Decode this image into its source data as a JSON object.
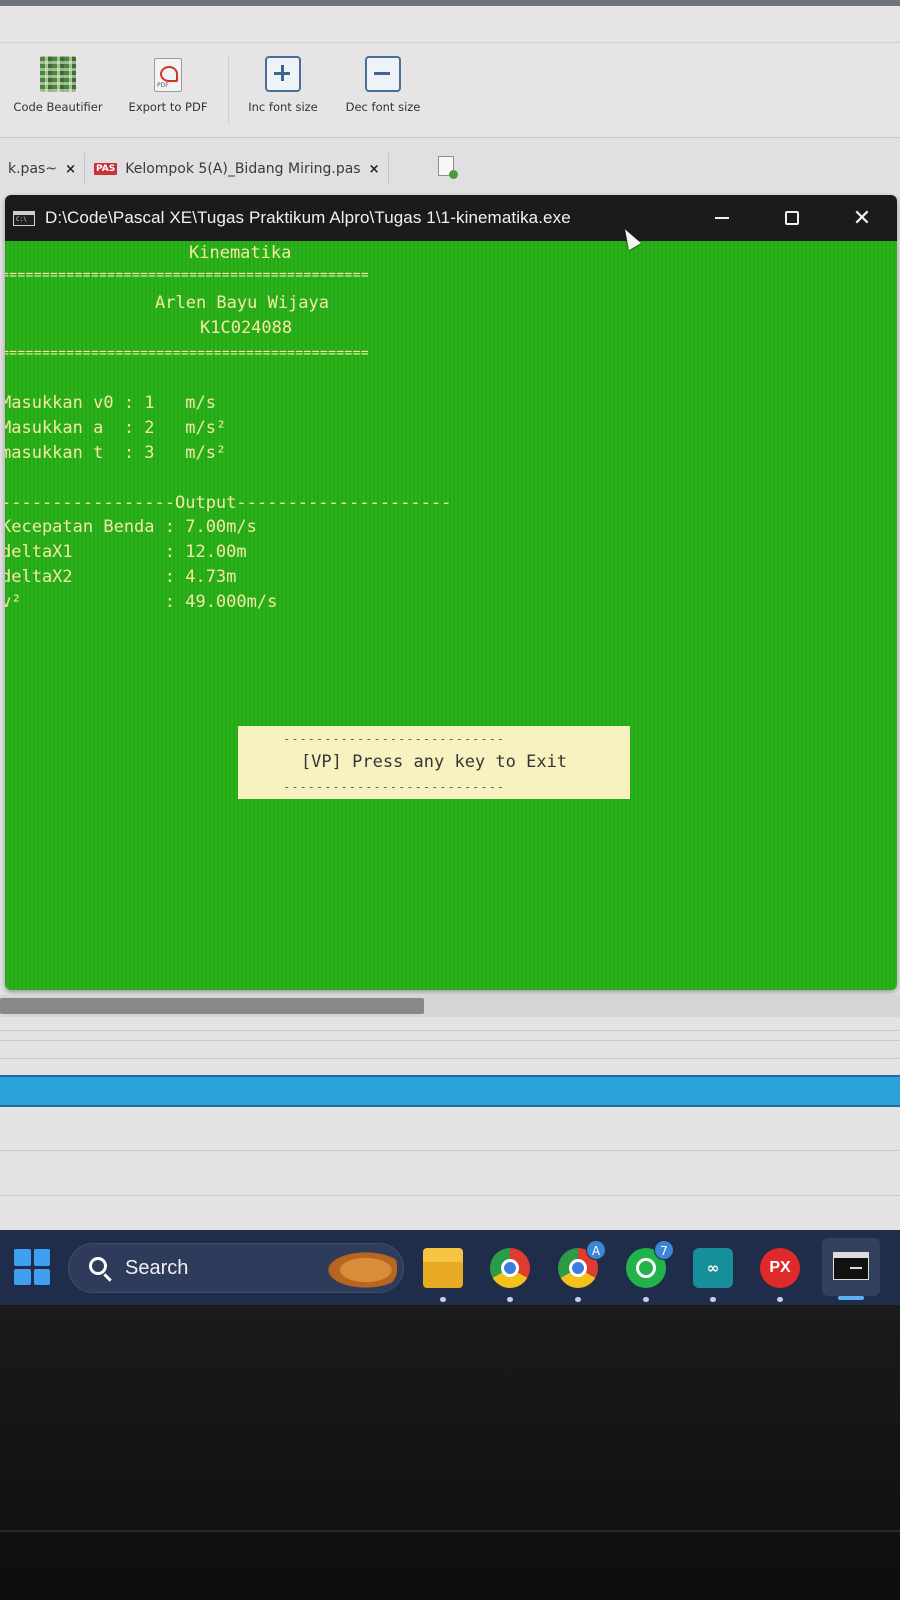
{
  "ribbon": {
    "tools": [
      {
        "label": "Code Beautifier",
        "icon": "code-beautifier-icon"
      },
      {
        "label": "Export to PDF",
        "icon": "pdf-icon"
      },
      {
        "label": "Inc font size",
        "icon": "plus-icon"
      },
      {
        "label": "Dec font size",
        "icon": "minus-icon"
      }
    ]
  },
  "tabs": [
    {
      "label": "k.pas~",
      "close": "×"
    },
    {
      "label": "Kelompok 5(A)_Bidang Miring.pas",
      "close": "×",
      "badge": "PAS"
    }
  ],
  "console": {
    "title": "D:\\Code\\Pascal XE\\Tugas Praktikum Alpro\\Tugas 1\\1-kinematika.exe",
    "icon_text": "C:\\",
    "controls": {
      "close": "✕"
    },
    "lines": {
      "heading": "Kinematika",
      "sep1": "=============================================",
      "author": "Arlen Bayu Wijaya",
      "nim": "K1C024088",
      "sep2": "=============================================",
      "in_v0": "Masukkan v0 : 1   m/s",
      "in_a": "Masukkan a  : 2   m/s²",
      "in_t": "masukkan t  : 3   m/s²",
      "out_sep": "-----------------Output---------------------",
      "out_speed": "Kecepatan Benda : 7.00m/s",
      "out_dx1": "deltaX1         : 12.00m",
      "out_dx2": "deltaX2         : 4.73m",
      "out_v2": "v²              : 49.000m/s"
    },
    "prompt": {
      "dashes": "---------------------------",
      "text": "[VP] Press any key to Exit"
    },
    "colors": {
      "background": "#2aae18",
      "text": "#f6e9a6",
      "prompt_bg": "#f8f2c0"
    }
  },
  "taskbar": {
    "search_label": "Search",
    "apps": [
      {
        "name": "file-explorer"
      },
      {
        "name": "chrome"
      },
      {
        "name": "chrome-profile",
        "badge": "A"
      },
      {
        "name": "whatsapp",
        "badge": "7"
      },
      {
        "name": "arduino",
        "text": "∞"
      },
      {
        "name": "px-app",
        "text": "PX"
      },
      {
        "name": "terminal"
      }
    ]
  }
}
